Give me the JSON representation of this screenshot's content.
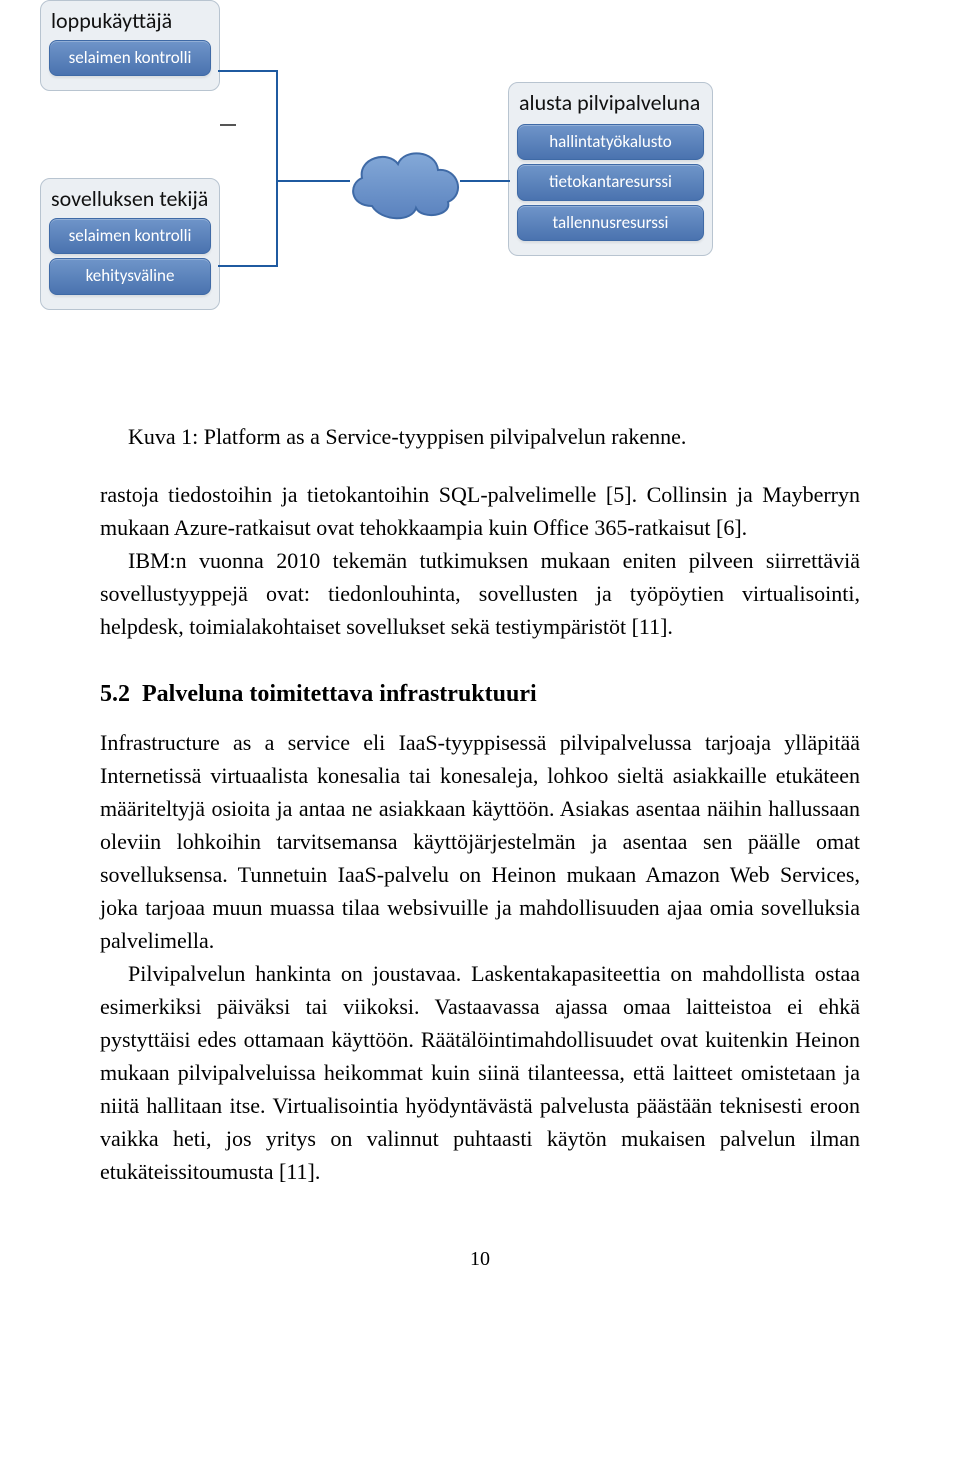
{
  "diagram": {
    "group_loppu": {
      "title": "loppukäyttäjä",
      "items": [
        "selaimen kontrolli"
      ]
    },
    "group_sovel": {
      "title": "sovelluksen tekijä",
      "items": [
        "selaimen kontrolli",
        "kehitysväline"
      ]
    },
    "group_alusta": {
      "title": "alusta pilvipalveluna",
      "items": [
        "hallintatyökalusto",
        "tietokantaresurssi",
        "tallennusresurssi"
      ]
    }
  },
  "figure_caption": "Kuva 1: Platform as a Service-tyyppisen pilvipalvelun rakenne.",
  "para1": "rastoja tiedostoihin ja tietokantoihin SQL-palvelimelle [5]. Collinsin ja Mayberryn mukaan Azure-ratkaisut ovat tehokkaampia kuin Office 365-ratkaisut [6].",
  "para2": "IBM:n vuonna 2010 tekemän tutkimuksen mukaan eniten pilveen siirrettäviä sovellustyyppejä ovat: tiedonlouhinta, sovellusten ja työpöytien virtualisointi, helpdesk, toimialakohtaiset sovellukset sekä testiympäristöt [11].",
  "section": {
    "number": "5.2",
    "title": "Palveluna toimitettava infrastruktuuri"
  },
  "para3": "Infrastructure as a service eli IaaS-tyyppisessä pilvipalvelussa tarjoaja ylläpitää Internetissä virtuaalista konesalia tai konesaleja, lohkoo sieltä asiakkaille etukäteen määriteltyjä osioita ja antaa ne asiakkaan käyttöön. Asiakas asentaa näihin hallussaan oleviin lohkoihin tarvitsemansa käyttöjärjestelmän ja asentaa sen päälle omat sovelluksensa. Tunnetuin IaaS-palvelu on Heinon mukaan Amazon Web Services, joka tarjoaa muun muassa tilaa websivuille ja mahdollisuuden ajaa omia sovelluksia palvelimella.",
  "para4": "Pilvipalvelun hankinta on joustavaa. Laskentakapasiteettia on mahdollista ostaa esimerkiksi päiväksi tai viikoksi. Vastaavassa ajassa omaa laitteistoa ei ehkä pystyttäisi edes ottamaan käyttöön. Räätälöintimahdollisuudet ovat kuitenkin Heinon mukaan pilvipalveluissa heikommat kuin siinä tilanteessa, että laitteet omistetaan ja niitä hallitaan itse. Virtualisointia hyödyntävästä palvelusta päästään teknisesti eroon vaikka heti, jos yritys on valinnut puhtaasti käytön mukaisen palvelun ilman etukäteissitoumusta [11].",
  "page_number": "10"
}
